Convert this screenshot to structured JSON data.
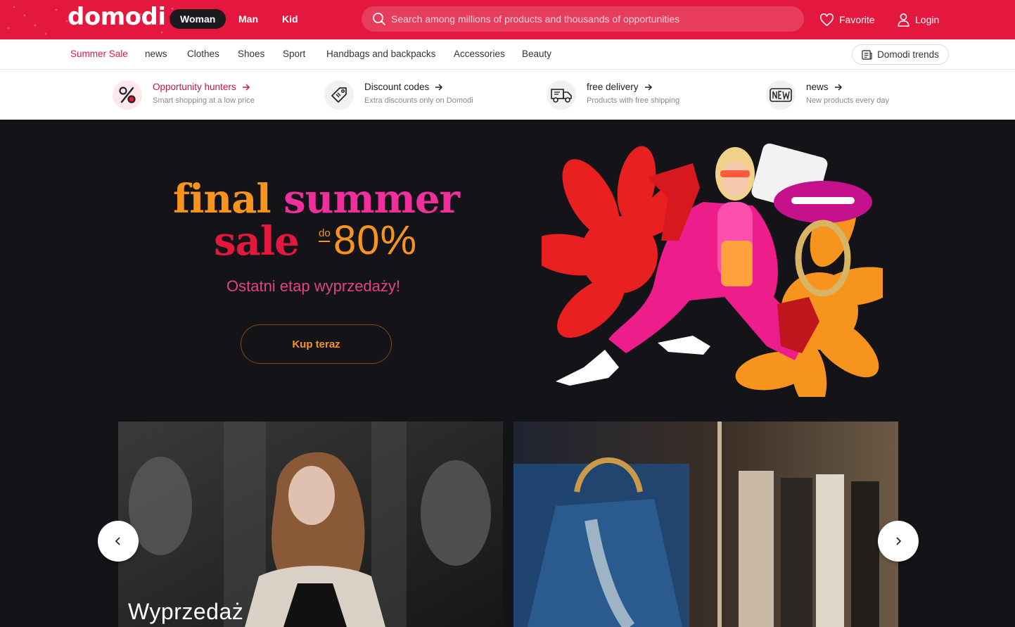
{
  "brand": {
    "logo": "domodi",
    "accent": "#e4173e"
  },
  "header": {
    "genders": [
      {
        "label": "Woman",
        "active": true
      },
      {
        "label": "Man",
        "active": false
      },
      {
        "label": "Kid",
        "active": false
      }
    ],
    "search_placeholder": "Search among millions of products and thousands of opportunities",
    "favorite_label": "Favorite",
    "login_label": "Login"
  },
  "nav": {
    "categories": [
      "Summer Sale",
      "news",
      "Clothes",
      "Shoes",
      "Sport",
      "Handbags and backpacks",
      "Accessories",
      "Beauty"
    ],
    "trends_label": "Domodi trends"
  },
  "features": [
    {
      "title": "Opportunity hunters",
      "subtitle": "Smart shopping at a low price",
      "icon": "percent-icon"
    },
    {
      "title": "Discount codes",
      "subtitle": "Extra discounts only on Domodi",
      "icon": "tag-icon"
    },
    {
      "title": "free delivery",
      "subtitle": "Products with free shipping",
      "icon": "truck-icon"
    },
    {
      "title": "news",
      "subtitle": "New products every day",
      "icon": "new-badge-icon"
    }
  ],
  "hero": {
    "title_word1": "final",
    "title_word2": "summer",
    "title_word3": "sale",
    "discount_prefix": "do",
    "discount": "-80%",
    "discount_value": "80%",
    "subtitle": "Ostatni etap wyprzedaży!",
    "cta_label": "Kup teraz",
    "colors": {
      "orange": "#f7941d",
      "pink": "#ef2f9b",
      "red": "#e4173e"
    }
  },
  "tiles": [
    {
      "label": "Wyprzedaż"
    },
    {
      "label": ""
    }
  ],
  "carousel": {
    "prev_symbol": "‹",
    "next_symbol": "›"
  }
}
